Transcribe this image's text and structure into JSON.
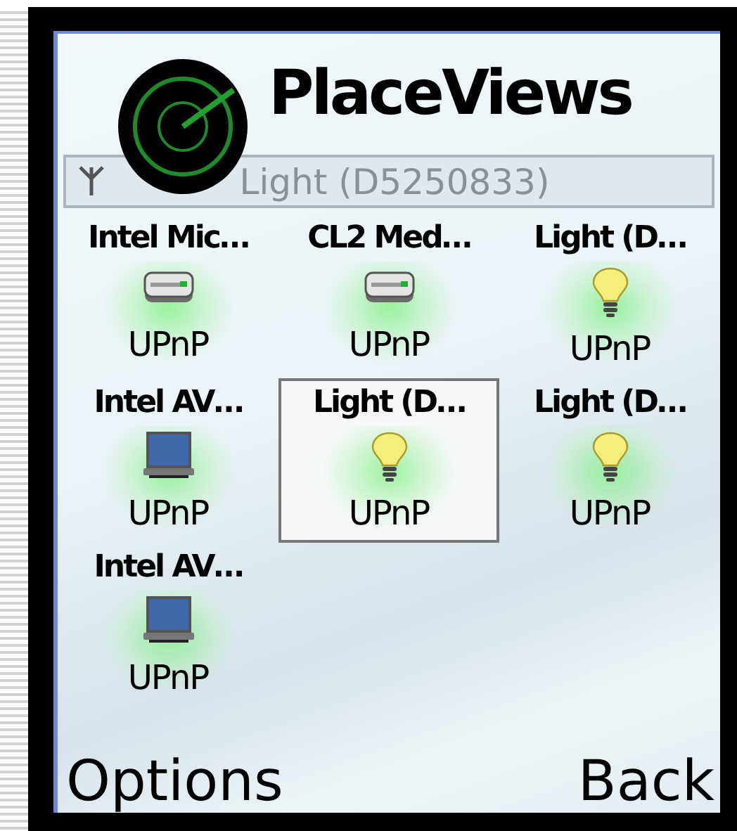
{
  "title": "PlaceViews",
  "status": {
    "text": "Light (D5250833)"
  },
  "devices": [
    {
      "name": "Intel Mic…",
      "kind": "storage",
      "protocol": "UPnP",
      "selected": false
    },
    {
      "name": "CL2 Med…",
      "kind": "storage",
      "protocol": "UPnP",
      "selected": false
    },
    {
      "name": "Light (D…",
      "kind": "light",
      "protocol": "UPnP",
      "selected": false
    },
    {
      "name": "Intel AV…",
      "kind": "monitor",
      "protocol": "UPnP",
      "selected": false
    },
    {
      "name": "Light (D…",
      "kind": "light",
      "protocol": "UPnP",
      "selected": true
    },
    {
      "name": "Light (D…",
      "kind": "light",
      "protocol": "UPnP",
      "selected": false
    },
    {
      "name": "Intel AV…",
      "kind": "monitor",
      "protocol": "UPnP",
      "selected": false
    }
  ],
  "softkeys": {
    "left": "Options",
    "right": "Back"
  }
}
